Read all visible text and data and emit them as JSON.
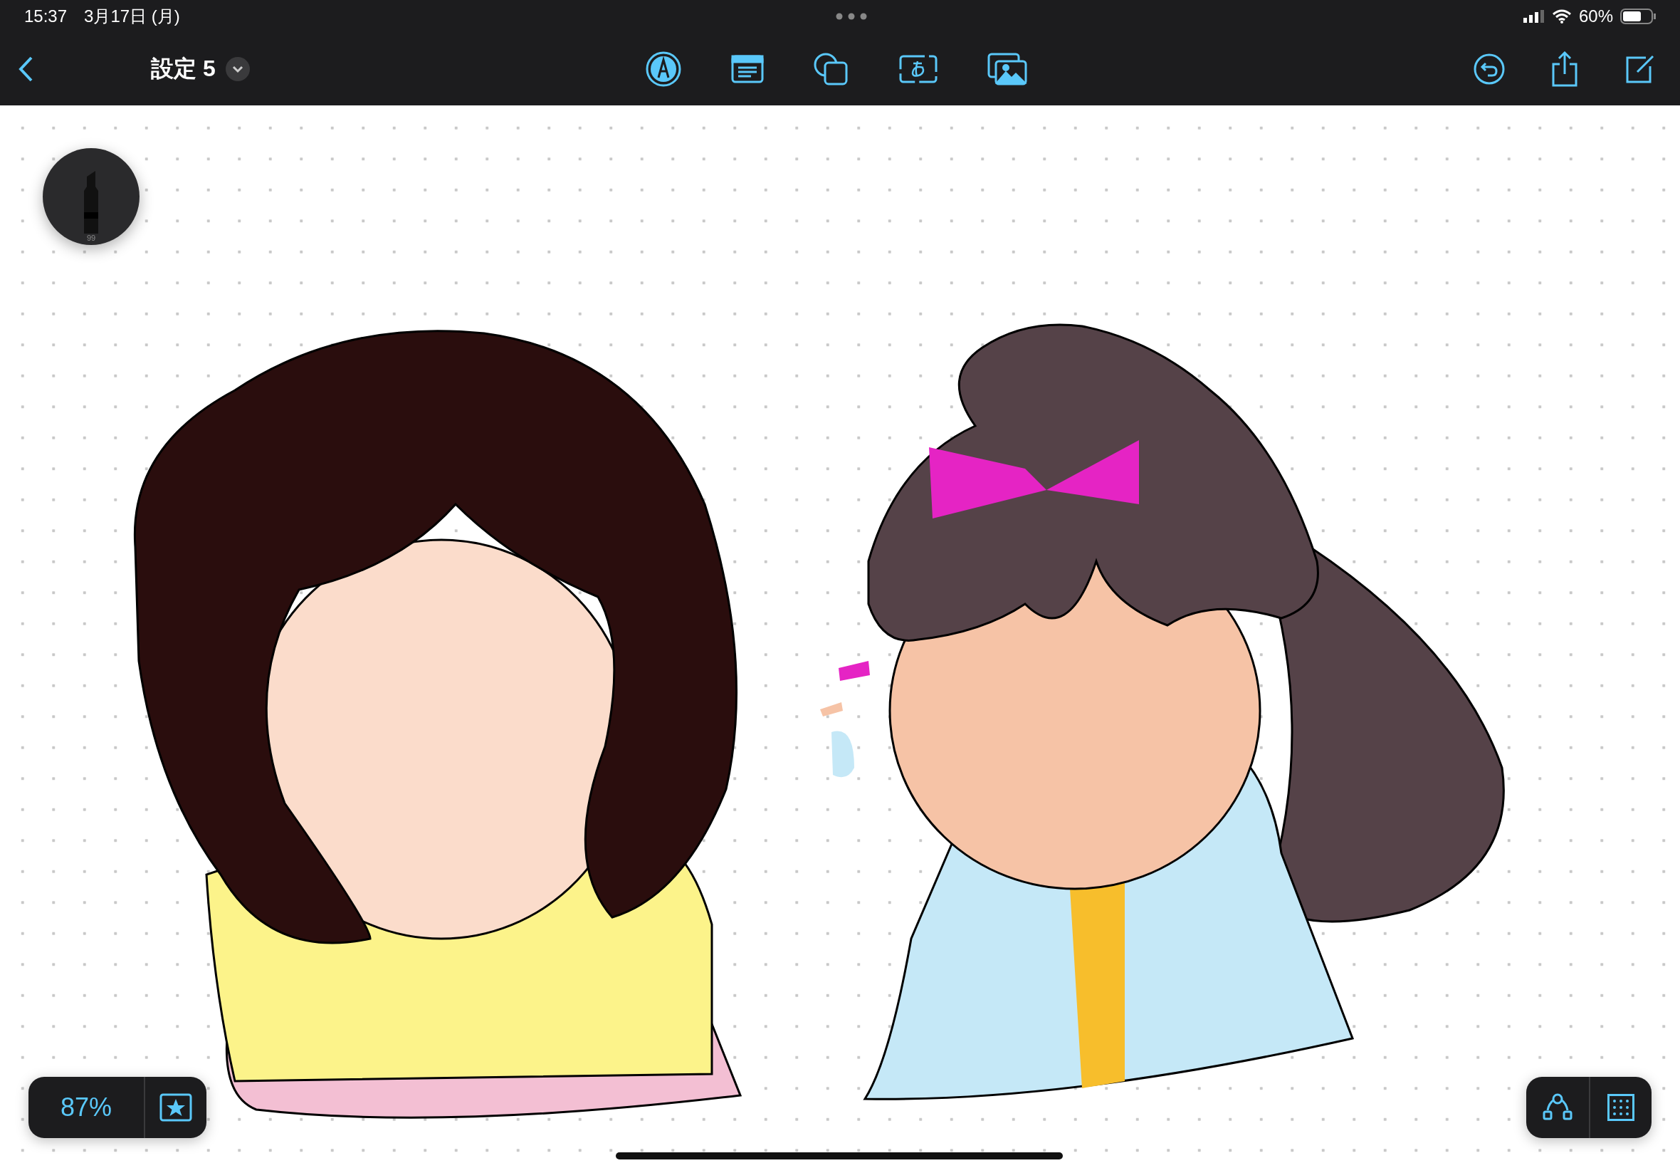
{
  "status_bar": {
    "time": "15:37",
    "date": "3月17日 (月)",
    "battery": "60%"
  },
  "toolbar": {
    "title": "設定 5"
  },
  "pen_puck": {
    "label": "99"
  },
  "zoom_control": {
    "zoom": "87%"
  }
}
